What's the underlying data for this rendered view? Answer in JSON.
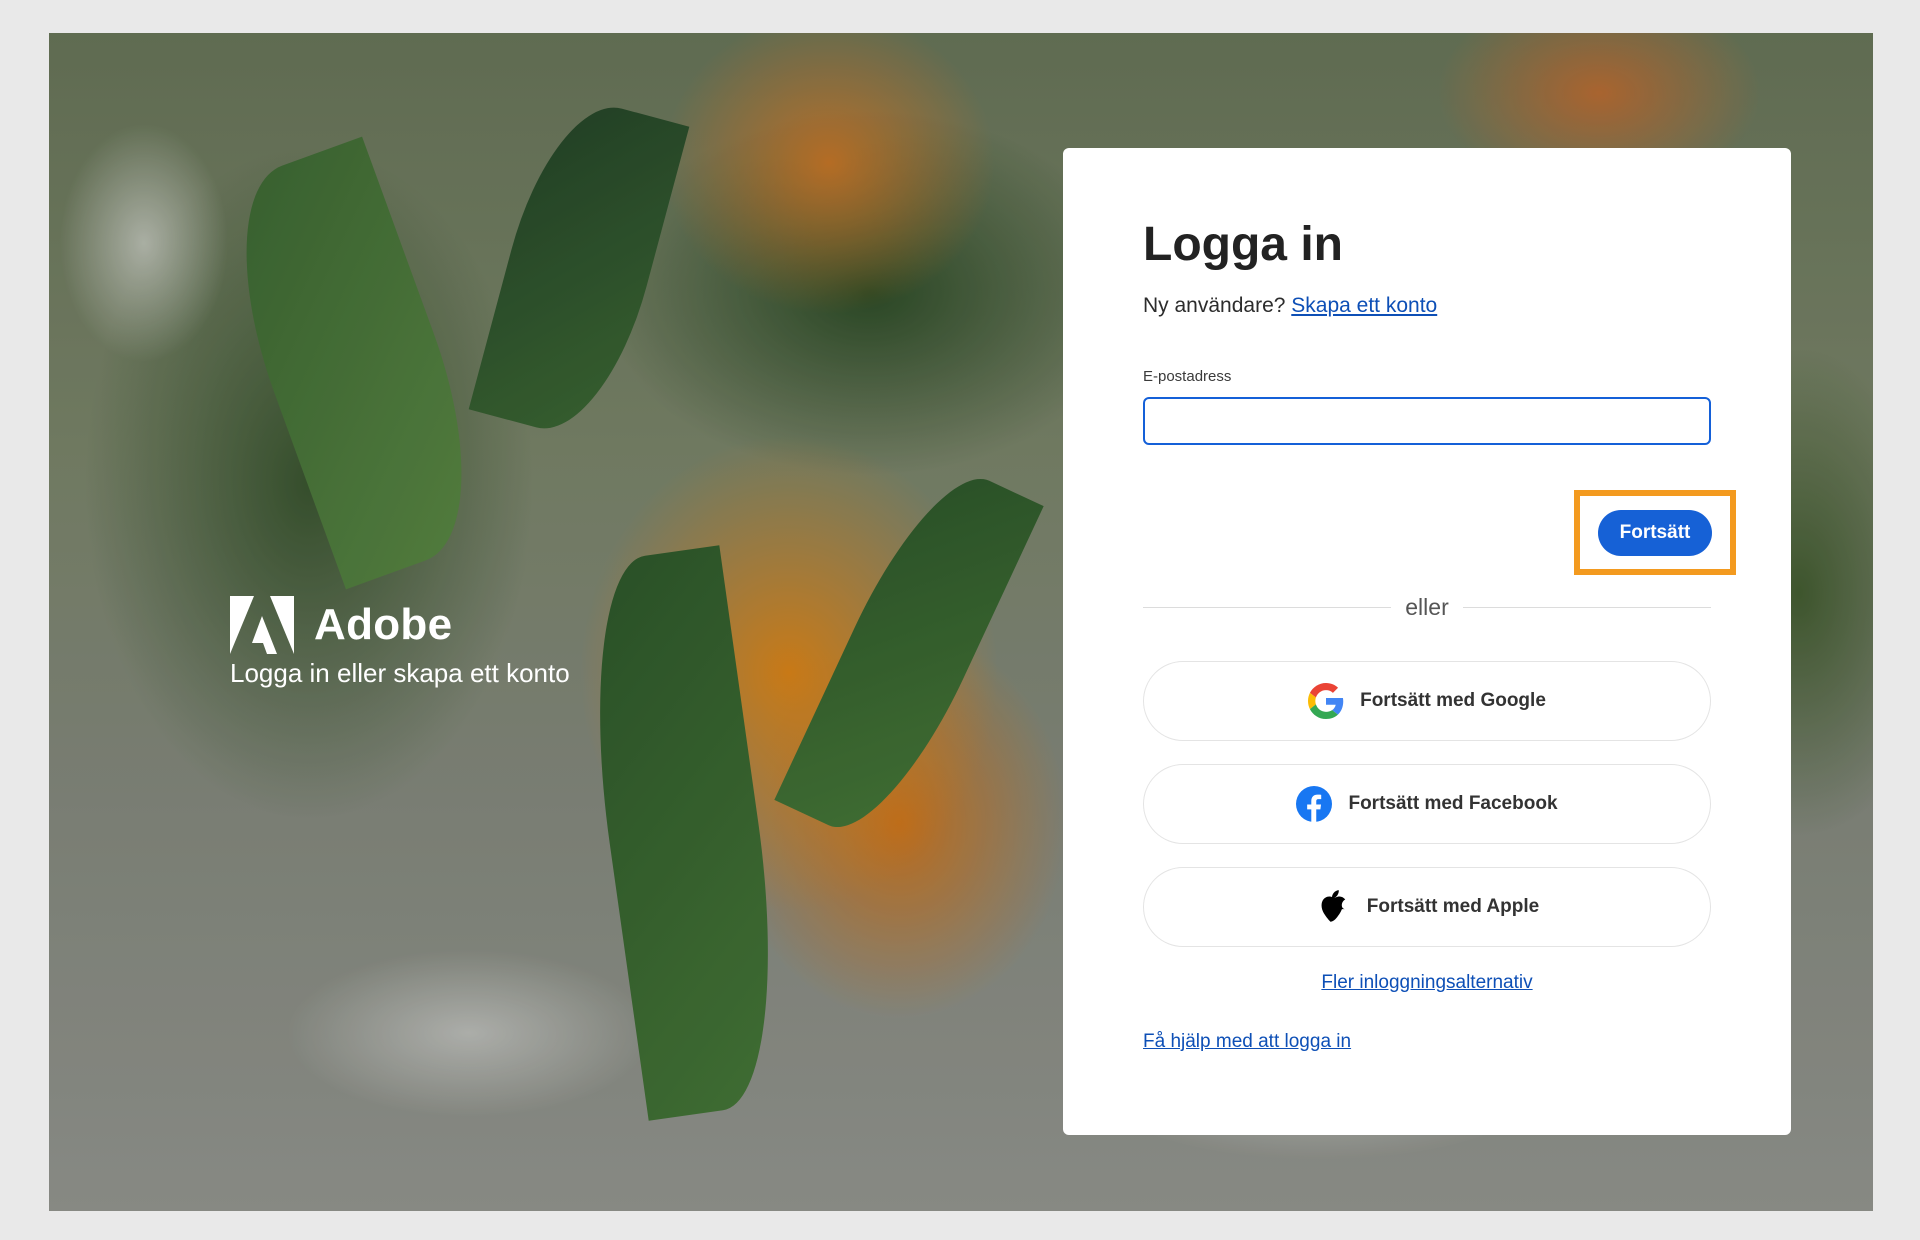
{
  "brand": {
    "name": "Adobe",
    "tagline": "Logga in eller skapa ett konto"
  },
  "login": {
    "title": "Logga in",
    "new_user_prompt": "Ny användare?",
    "create_account_link": "Skapa ett konto",
    "email_label": "E-postadress",
    "email_value": "",
    "continue_button": "Fortsätt",
    "divider_text": "eller",
    "social_buttons": {
      "google": "Fortsätt med Google",
      "facebook": "Fortsätt med Facebook",
      "apple": "Fortsätt med Apple"
    },
    "more_options_link": "Fler inloggningsalternativ",
    "help_link": "Få hjälp med att logga in"
  },
  "colors": {
    "accent": "#1661d6",
    "link": "#0d4fb6",
    "highlight": "#f39a1f"
  },
  "icons": [
    "adobe-logo-icon",
    "google-icon",
    "facebook-icon",
    "apple-icon"
  ]
}
